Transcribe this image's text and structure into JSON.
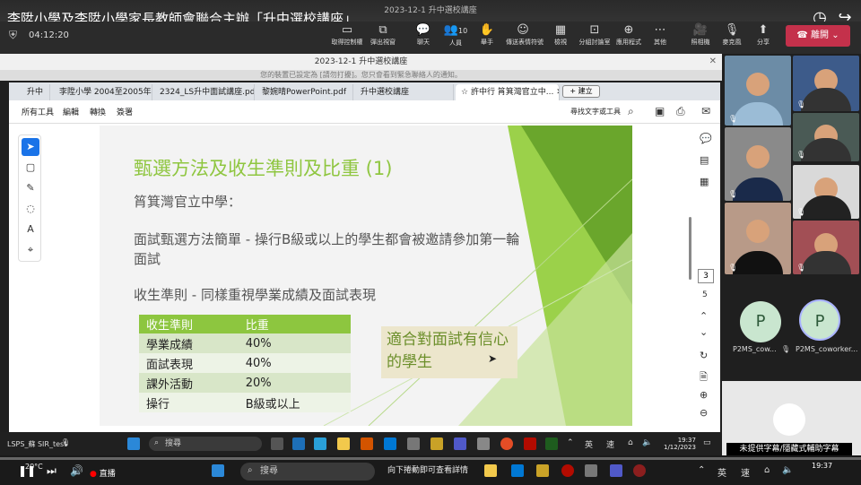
{
  "yt": {
    "title": "李陞小學及李陞小學家長教師會聯合主辦「升中選校講座」",
    "live_label": "直播"
  },
  "teams": {
    "elapsed": "04:12:20",
    "window_title": "2023-12-1 升中選校講座",
    "buttons": [
      {
        "label": "取得控制權",
        "icon": "▭"
      },
      {
        "label": "彈出視窗",
        "icon": "⧉"
      },
      {
        "label": "聊天",
        "icon": "💬"
      },
      {
        "label": "人員",
        "icon": "👥",
        "badge": "10"
      },
      {
        "label": "舉手",
        "icon": "✋"
      },
      {
        "label": "傳送表情符號",
        "icon": "☺"
      },
      {
        "label": "檢視",
        "icon": "▦"
      },
      {
        "label": "分組討論室",
        "icon": "⊡"
      },
      {
        "label": "應用程式",
        "icon": "⊕"
      },
      {
        "label": "其他",
        "icon": "⋯"
      },
      {
        "label": "照相機",
        "icon": "🎥"
      },
      {
        "label": "麥克風",
        "icon": "🎙"
      },
      {
        "label": "分享",
        "icon": "⬆"
      }
    ],
    "leave_label": "離開"
  },
  "shared": {
    "window_title": "2023-12-1 升中選校講座",
    "notice": "您的裝置已設定為 [請勿打擾]。您只會看到緊急聯絡人的通知。"
  },
  "browser": {
    "tabs": [
      "升中",
      "李陞小學 2004至2005年...",
      "2324_LS升中面試講座.pdf",
      "黎婉晴PowerPoint.pdf",
      "升中選校講座",
      "許中行 筲箕灣官立中..."
    ],
    "new_tab": "+ 建立",
    "menus": [
      "所有工具",
      "編輯",
      "轉換",
      "簽署"
    ],
    "find_label": "尋找文字或工具",
    "page_current": "3",
    "page_total": "5"
  },
  "slide": {
    "title": "甄選方法及收生準則及比重 (1)",
    "school": "筲箕灣官立中學：",
    "method": "面試甄選方法簡單 - 操行B級或以上的學生都會被邀請參加第一輪面試",
    "criteria": "收生準則 - 同樣重視學業成績及面試表現",
    "table_header": [
      "收生準則",
      "比重"
    ],
    "table_rows": [
      [
        "學業成績",
        "40%"
      ],
      [
        "面試表現",
        "40%"
      ],
      [
        "課外活動",
        "20%"
      ],
      [
        "操行",
        "B級或以上"
      ]
    ],
    "callout": "適合對面試有信心的學生"
  },
  "participants": {
    "names": [
      "P2MS_cow...",
      "P2MS_coworker..."
    ],
    "initial": "P"
  },
  "inner_taskbar": {
    "user_label": "LSPS_蘇 SIR_test",
    "search": "搜尋",
    "ime1": "英",
    "ime2": "速",
    "time": "19:37",
    "date": "1/12/2023"
  },
  "captions_label": "未提供字幕/隱藏式輔助字幕",
  "outer_taskbar": {
    "weather": "20°C",
    "search": "搜尋",
    "hint": "向下捲動即可查看詳情",
    "ime1": "英",
    "ime2": "速",
    "time": "19:37"
  },
  "colors": {
    "slide_green": "#8dc63f",
    "leave_red": "#c4314b"
  }
}
